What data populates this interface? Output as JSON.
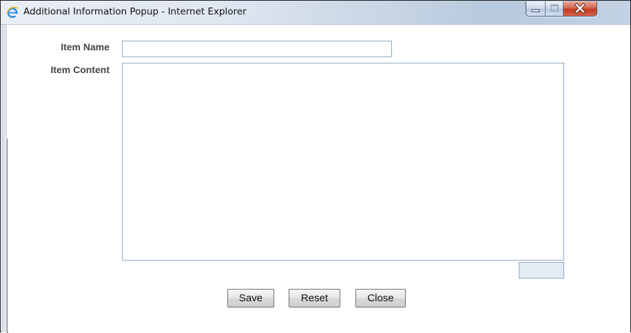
{
  "window": {
    "title": "Additional Information Popup - Internet Explorer",
    "icon": "internet-explorer-icon",
    "controls": [
      "minimize-icon",
      "maximize-icon",
      "close-icon"
    ]
  },
  "form": {
    "item_name_label": "Item Name",
    "item_name_value": "",
    "item_content_label": "Item Content",
    "item_content_value": "",
    "char_counter_value": ""
  },
  "buttons": {
    "save_label": "Save",
    "reset_label": "Reset",
    "close_label": "Close"
  },
  "colors": {
    "field_border": "#8fa9c2",
    "label_text": "#444444",
    "close_button_red": "#c0391f"
  }
}
